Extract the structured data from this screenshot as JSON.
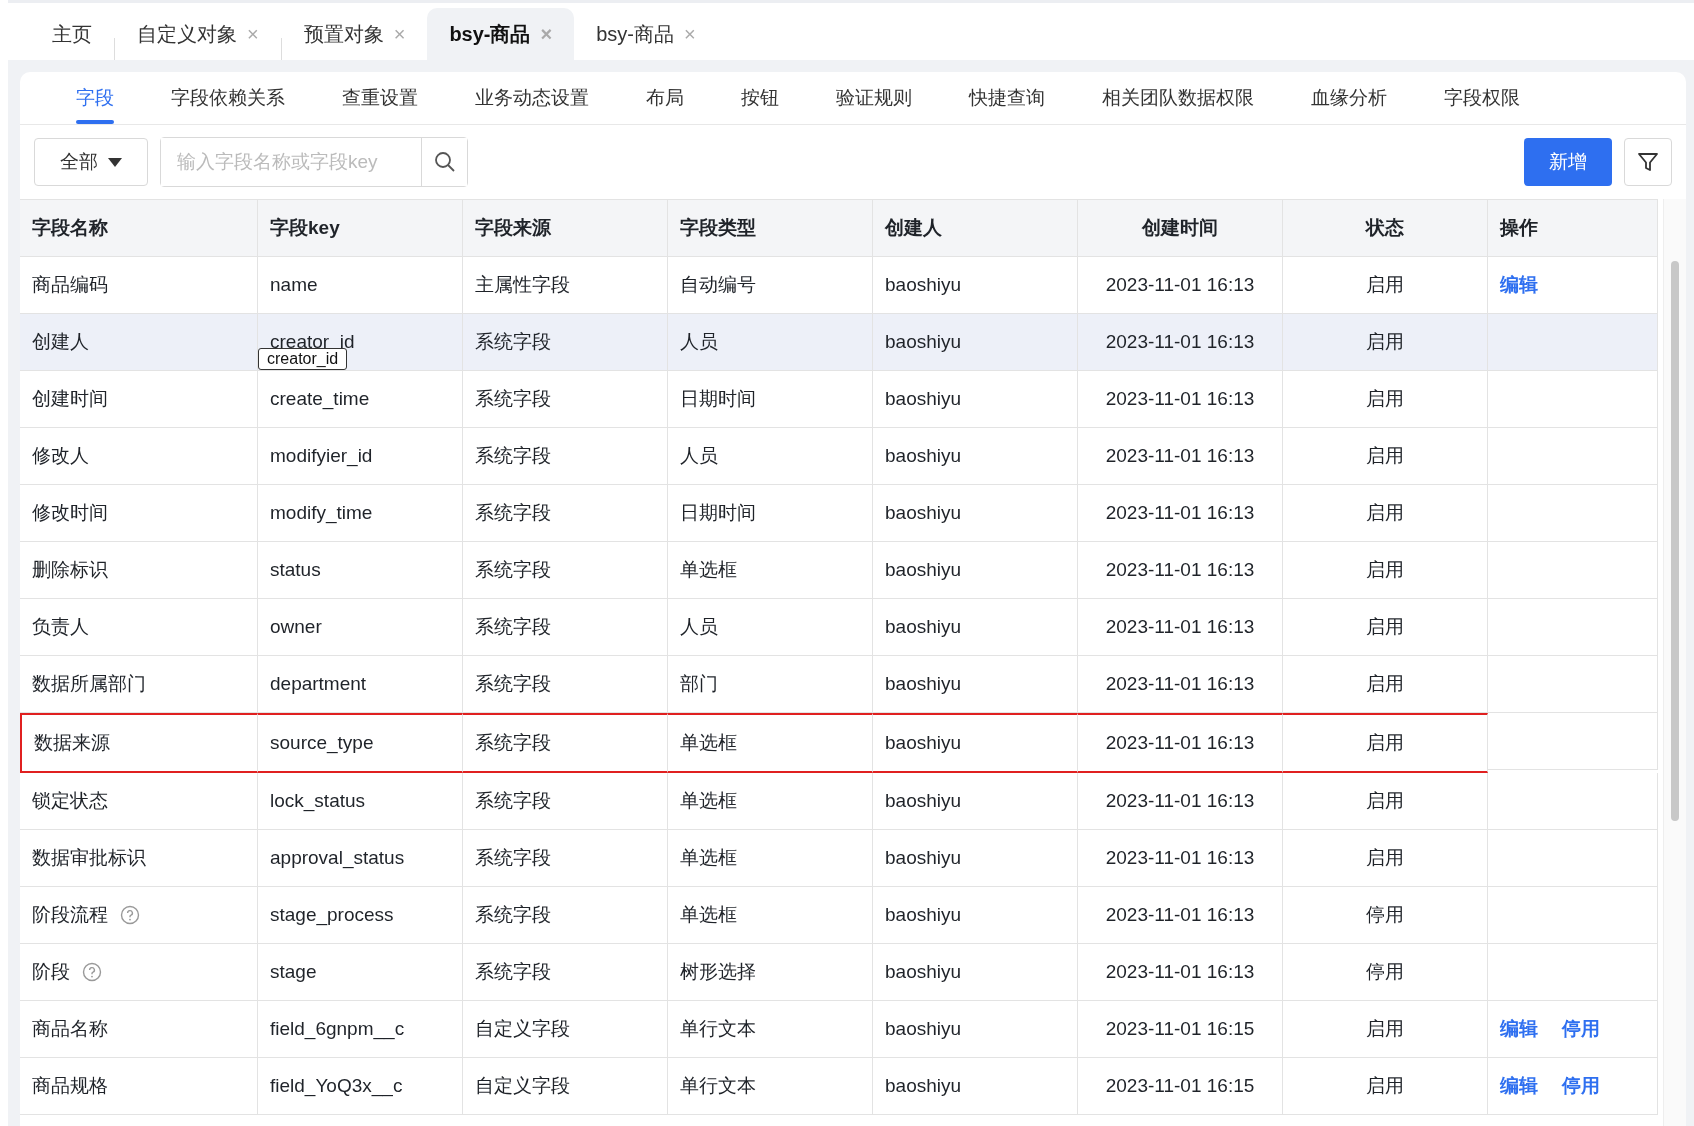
{
  "top_tabs": [
    {
      "label": "主页",
      "closable": false,
      "selected": false
    },
    {
      "label": "自定义对象",
      "closable": true,
      "selected": false
    },
    {
      "label": "预置对象",
      "closable": true,
      "selected": false
    },
    {
      "label": "bsy-商品",
      "closable": true,
      "selected": true
    },
    {
      "label": "bsy-商品",
      "closable": true,
      "selected": false
    }
  ],
  "close_glyph": "×",
  "sub_tabs": [
    {
      "label": "字段",
      "selected": true
    },
    {
      "label": "字段依赖关系",
      "selected": false
    },
    {
      "label": "查重设置",
      "selected": false
    },
    {
      "label": "业务动态设置",
      "selected": false
    },
    {
      "label": "布局",
      "selected": false
    },
    {
      "label": "按钮",
      "selected": false
    },
    {
      "label": "验证规则",
      "selected": false
    },
    {
      "label": "快捷查询",
      "selected": false
    },
    {
      "label": "相关团队数据权限",
      "selected": false
    },
    {
      "label": "血缘分析",
      "selected": false
    },
    {
      "label": "字段权限",
      "selected": false
    }
  ],
  "toolbar": {
    "filter_select": "全部",
    "search": {
      "placeholder": "输入字段名称或字段key"
    },
    "add_button": "新增"
  },
  "table": {
    "columns": [
      "字段名称",
      "字段key",
      "字段来源",
      "字段类型",
      "创建人",
      "创建时间",
      "状态",
      "操作"
    ],
    "rows": [
      {
        "cells": [
          "商品编码",
          "name",
          "主属性字段",
          "自动编号",
          "baoshiyu",
          "2023-11-01 16:13",
          "启用"
        ],
        "help": false,
        "hovered": false,
        "highlighted": false,
        "actions": [
          "编辑"
        ]
      },
      {
        "cells": [
          "创建人",
          "creator_id",
          "系统字段",
          "人员",
          "baoshiyu",
          "2023-11-01 16:13",
          "启用"
        ],
        "help": false,
        "hovered": true,
        "highlighted": false,
        "actions": [],
        "tooltip": "creator_id"
      },
      {
        "cells": [
          "创建时间",
          "create_time",
          "系统字段",
          "日期时间",
          "baoshiyu",
          "2023-11-01 16:13",
          "启用"
        ],
        "help": false,
        "hovered": false,
        "highlighted": false,
        "actions": []
      },
      {
        "cells": [
          "修改人",
          "modifyier_id",
          "系统字段",
          "人员",
          "baoshiyu",
          "2023-11-01 16:13",
          "启用"
        ],
        "help": false,
        "hovered": false,
        "highlighted": false,
        "actions": []
      },
      {
        "cells": [
          "修改时间",
          "modify_time",
          "系统字段",
          "日期时间",
          "baoshiyu",
          "2023-11-01 16:13",
          "启用"
        ],
        "help": false,
        "hovered": false,
        "highlighted": false,
        "actions": []
      },
      {
        "cells": [
          "删除标识",
          "status",
          "系统字段",
          "单选框",
          "baoshiyu",
          "2023-11-01 16:13",
          "启用"
        ],
        "help": false,
        "hovered": false,
        "highlighted": false,
        "actions": []
      },
      {
        "cells": [
          "负责人",
          "owner",
          "系统字段",
          "人员",
          "baoshiyu",
          "2023-11-01 16:13",
          "启用"
        ],
        "help": false,
        "hovered": false,
        "highlighted": false,
        "actions": []
      },
      {
        "cells": [
          "数据所属部门",
          "department",
          "系统字段",
          "部门",
          "baoshiyu",
          "2023-11-01 16:13",
          "启用"
        ],
        "help": false,
        "hovered": false,
        "highlighted": false,
        "actions": []
      },
      {
        "cells": [
          "数据来源",
          "source_type",
          "系统字段",
          "单选框",
          "baoshiyu",
          "2023-11-01 16:13",
          "启用"
        ],
        "help": false,
        "hovered": false,
        "highlighted": true,
        "actions": []
      },
      {
        "cells": [
          "锁定状态",
          "lock_status",
          "系统字段",
          "单选框",
          "baoshiyu",
          "2023-11-01 16:13",
          "启用"
        ],
        "help": false,
        "hovered": false,
        "highlighted": false,
        "actions": []
      },
      {
        "cells": [
          "数据审批标识",
          "approval_status",
          "系统字段",
          "单选框",
          "baoshiyu",
          "2023-11-01 16:13",
          "启用"
        ],
        "help": false,
        "hovered": false,
        "highlighted": false,
        "actions": []
      },
      {
        "cells": [
          "阶段流程",
          "stage_process",
          "系统字段",
          "单选框",
          "baoshiyu",
          "2023-11-01 16:13",
          "停用"
        ],
        "help": true,
        "hovered": false,
        "highlighted": false,
        "actions": []
      },
      {
        "cells": [
          "阶段",
          "stage",
          "系统字段",
          "树形选择",
          "baoshiyu",
          "2023-11-01 16:13",
          "停用"
        ],
        "help": true,
        "hovered": false,
        "highlighted": false,
        "actions": []
      },
      {
        "cells": [
          "商品名称",
          "field_6gnpm__c",
          "自定义字段",
          "单行文本",
          "baoshiyu",
          "2023-11-01 16:15",
          "启用"
        ],
        "help": false,
        "hovered": false,
        "highlighted": false,
        "actions": [
          "编辑",
          "停用"
        ]
      },
      {
        "cells": [
          "商品规格",
          "field_YoQ3x__c",
          "自定义字段",
          "单行文本",
          "baoshiyu",
          "2023-11-01 16:15",
          "启用"
        ],
        "help": false,
        "hovered": false,
        "highlighted": false,
        "actions": [
          "编辑",
          "停用"
        ]
      }
    ]
  }
}
